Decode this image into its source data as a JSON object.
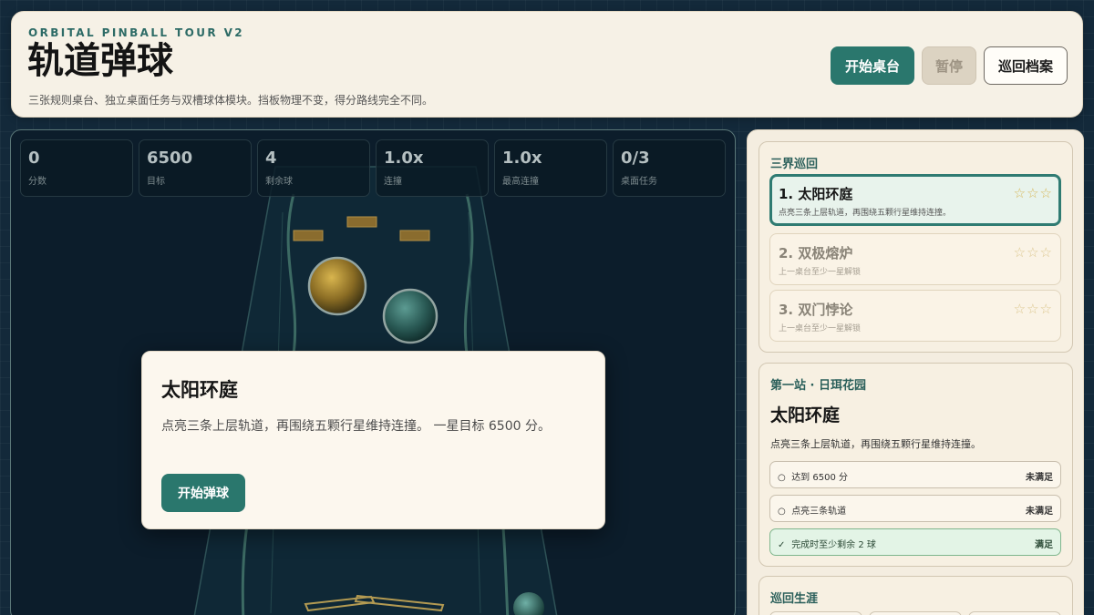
{
  "header": {
    "eyebrow": "ORBITAL PINBALL TOUR V2",
    "title": "轨道弹球",
    "subtitle": "三张规则桌台、独立桌面任务与双槽球体模块。挡板物理不变，得分路线完全不同。",
    "buttons": {
      "start": "开始桌台",
      "pause": "暂停",
      "archive": "巡回档案"
    }
  },
  "stats": [
    {
      "value": "0",
      "label": "分数"
    },
    {
      "value": "6500",
      "label": "目标"
    },
    {
      "value": "4",
      "label": "剩余球"
    },
    {
      "value": "1.0x",
      "label": "连撞"
    },
    {
      "value": "1.0x",
      "label": "最高连撞"
    },
    {
      "value": "0/3",
      "label": "桌面任务"
    }
  ],
  "modal": {
    "title": "太阳环庭",
    "description": "点亮三条上层轨道，再围绕五颗行星维持连撞。 一星目标 6500 分。",
    "button": "开始弹球"
  },
  "tour": {
    "title": "三界巡回",
    "items": [
      {
        "name": "1. 太阳环庭",
        "desc": "点亮三条上层轨道，再围绕五颗行星维持连撞。",
        "stars": "☆☆☆",
        "state": "active"
      },
      {
        "name": "2. 双极熔炉",
        "desc": "上一桌台至少一星解锁",
        "stars": "☆☆☆",
        "state": "locked"
      },
      {
        "name": "3. 双门悖论",
        "desc": "上一桌台至少一星解锁",
        "stars": "☆☆☆",
        "state": "locked"
      }
    ]
  },
  "stage": {
    "title": "第一站 · 日珥花园",
    "name": "太阳环庭",
    "desc": "点亮三条上层轨道，再围绕五颗行星维持连撞。",
    "tasks": [
      {
        "mark": "○",
        "label": "达到 6500 分",
        "status": "未满足",
        "done": false
      },
      {
        "mark": "○",
        "label": "点亮三条轨道",
        "status": "未满足",
        "done": false
      },
      {
        "mark": "✓",
        "label": "完成时至少剩余 2 球",
        "status": "满足",
        "done": true
      }
    ]
  },
  "career": {
    "title": "巡回生涯"
  },
  "colors": {
    "accent": "#2a776d",
    "background": "#13293a",
    "panel": "#f6f1e6",
    "star": "#d7b85a",
    "bumper_gold": "#c9a23a",
    "bumper_teal": "#3d7f78"
  }
}
